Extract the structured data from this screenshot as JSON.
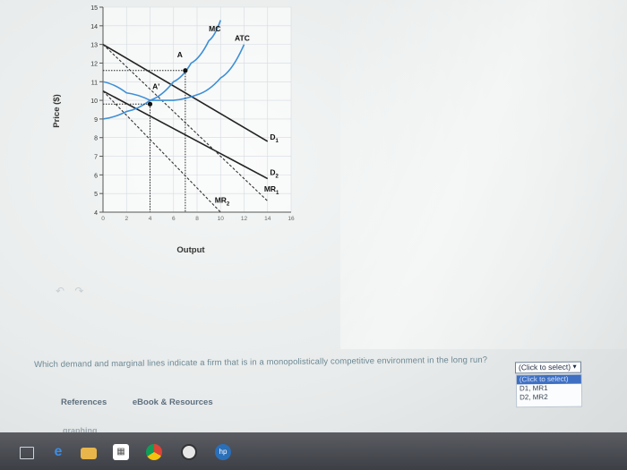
{
  "chart_data": {
    "type": "line",
    "ylabel": "Price ($)",
    "xlabel": "Output",
    "xlim": [
      0,
      16
    ],
    "ylim": [
      4,
      15
    ],
    "x_ticks": [
      "0",
      "2",
      "4",
      "6",
      "8",
      "10",
      "12",
      "14",
      "16"
    ],
    "y_ticks": [
      "4",
      "5",
      "6",
      "7",
      "8",
      "9",
      "10",
      "11",
      "12",
      "13",
      "14",
      "15"
    ],
    "series": [
      {
        "name": "D1",
        "x": [
          0,
          14
        ],
        "y": [
          13.0,
          7.8
        ]
      },
      {
        "name": "D2",
        "x": [
          0,
          14
        ],
        "y": [
          10.5,
          5.8
        ]
      },
      {
        "name": "MR1",
        "x": [
          0,
          14
        ],
        "y": [
          13.0,
          4.6
        ]
      },
      {
        "name": "MR2",
        "x": [
          0,
          10
        ],
        "y": [
          10.5,
          4.0
        ]
      },
      {
        "name": "MC",
        "x": [
          0,
          2,
          4,
          6,
          7.5,
          9,
          10
        ],
        "y": [
          9.0,
          9.4,
          10.0,
          11.0,
          12.0,
          13.2,
          14.3
        ]
      },
      {
        "name": "ATC",
        "x": [
          0,
          2,
          4,
          6,
          8,
          10,
          12
        ],
        "y": [
          11.0,
          10.4,
          10.0,
          10.0,
          10.3,
          11.2,
          13.0
        ]
      }
    ],
    "annotations": [
      {
        "text": "MC",
        "x": 9,
        "y": 13.7
      },
      {
        "text": "ATC",
        "x": 11.2,
        "y": 13.2
      },
      {
        "text": "A",
        "x": 6.3,
        "y": 12.3
      },
      {
        "text": "A'",
        "x": 4.2,
        "y": 10.6
      },
      {
        "text": "D1",
        "x": 14.2,
        "y": 7.9
      },
      {
        "text": "D2",
        "x": 14.2,
        "y": 6.0
      },
      {
        "text": "MR1",
        "x": 13.7,
        "y": 5.1
      },
      {
        "text": "MR2",
        "x": 9.5,
        "y": 4.5
      }
    ],
    "points": [
      {
        "name": "A",
        "x": 7,
        "y": 11.6
      },
      {
        "name": "A'",
        "x": 4,
        "y": 9.8
      }
    ]
  },
  "question": {
    "text": "Which demand and marginal lines indicate a firm that is in a monopolistically competitive environment in the long run?",
    "dropdown_value": "(Click to select)",
    "dropdown_arrow": "▼",
    "options": [
      "(Click to select)",
      "D1, MR1",
      "D2, MR2"
    ]
  },
  "links": {
    "references": "References",
    "ebook": "eBook & Resources"
  },
  "partial_bottom": "graphing",
  "back_icons": "↶ ↷",
  "colors": {
    "demand_line": "#222222",
    "mc_atc": "#3d8fd6",
    "background": "#eef0f0",
    "taskbar": "#4a4c52"
  },
  "taskbar_icons": [
    "task-view-icon",
    "edge-browser-icon",
    "folder-icon",
    "store-icon",
    "chrome-icon",
    "camera-icon",
    "hp-icon"
  ]
}
